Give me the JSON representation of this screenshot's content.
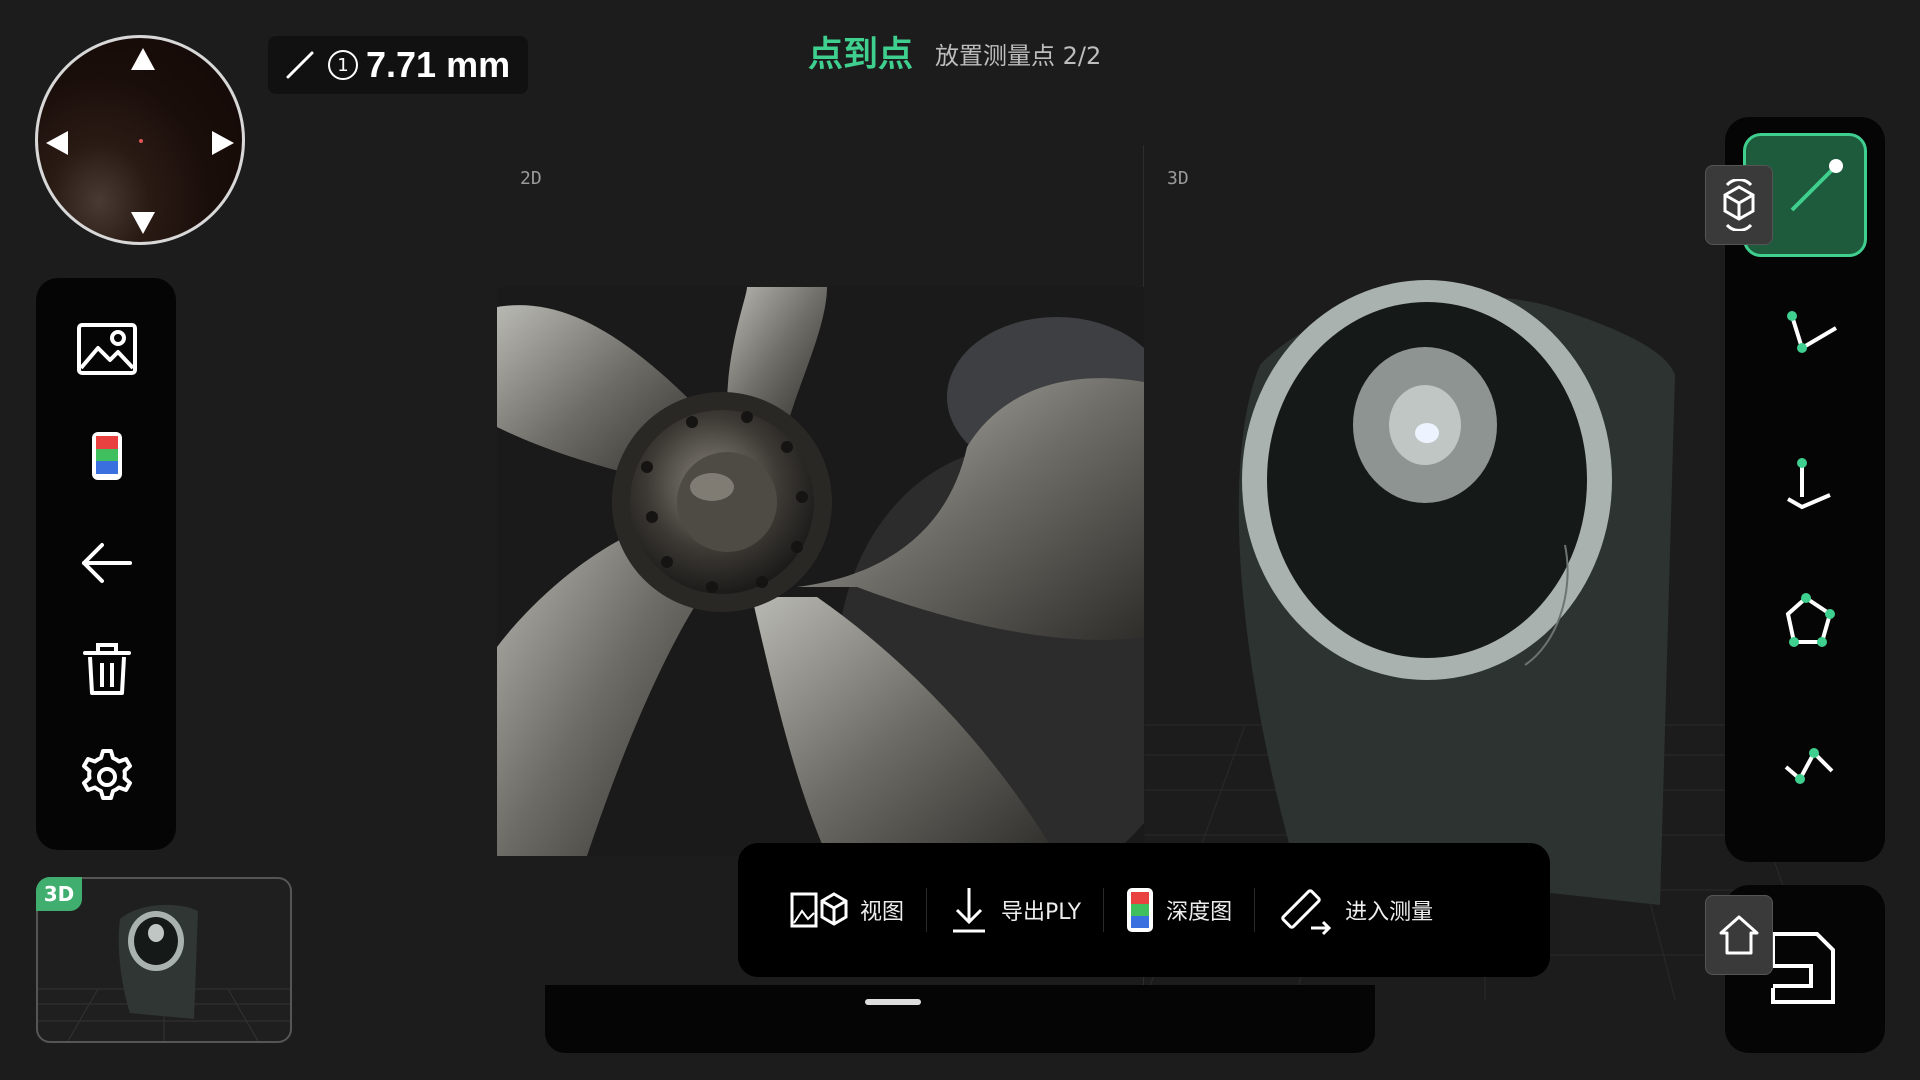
{
  "header": {
    "measure_value": "7.71 mm",
    "measure_index": "1",
    "title": "点到点",
    "subtitle": "放置测量点 2/2"
  },
  "views": {
    "left_label": "2D",
    "right_label": "3D"
  },
  "thumbnail": {
    "badge": "3D"
  },
  "left_toolbar": {
    "items": [
      "image-icon",
      "depth-map-icon",
      "back-arrow-icon",
      "trash-icon",
      "settings-gear-icon"
    ]
  },
  "right_toolbar": {
    "items": [
      "point-to-point-icon",
      "angle-icon",
      "height-icon",
      "polygon-area-icon",
      "polyline-icon"
    ],
    "active": "point-to-point-icon"
  },
  "bottom_bar": {
    "items": [
      {
        "label": "视图",
        "icon": "view-2d3d-icon"
      },
      {
        "label": "导出PLY",
        "icon": "download-icon"
      },
      {
        "label": "深度图",
        "icon": "depth-map-icon"
      },
      {
        "label": "进入测量",
        "icon": "ruler-icon"
      }
    ]
  },
  "colors": {
    "accent": "#3fcf8e",
    "background": "#1c1c1c",
    "panel": "#050505"
  }
}
